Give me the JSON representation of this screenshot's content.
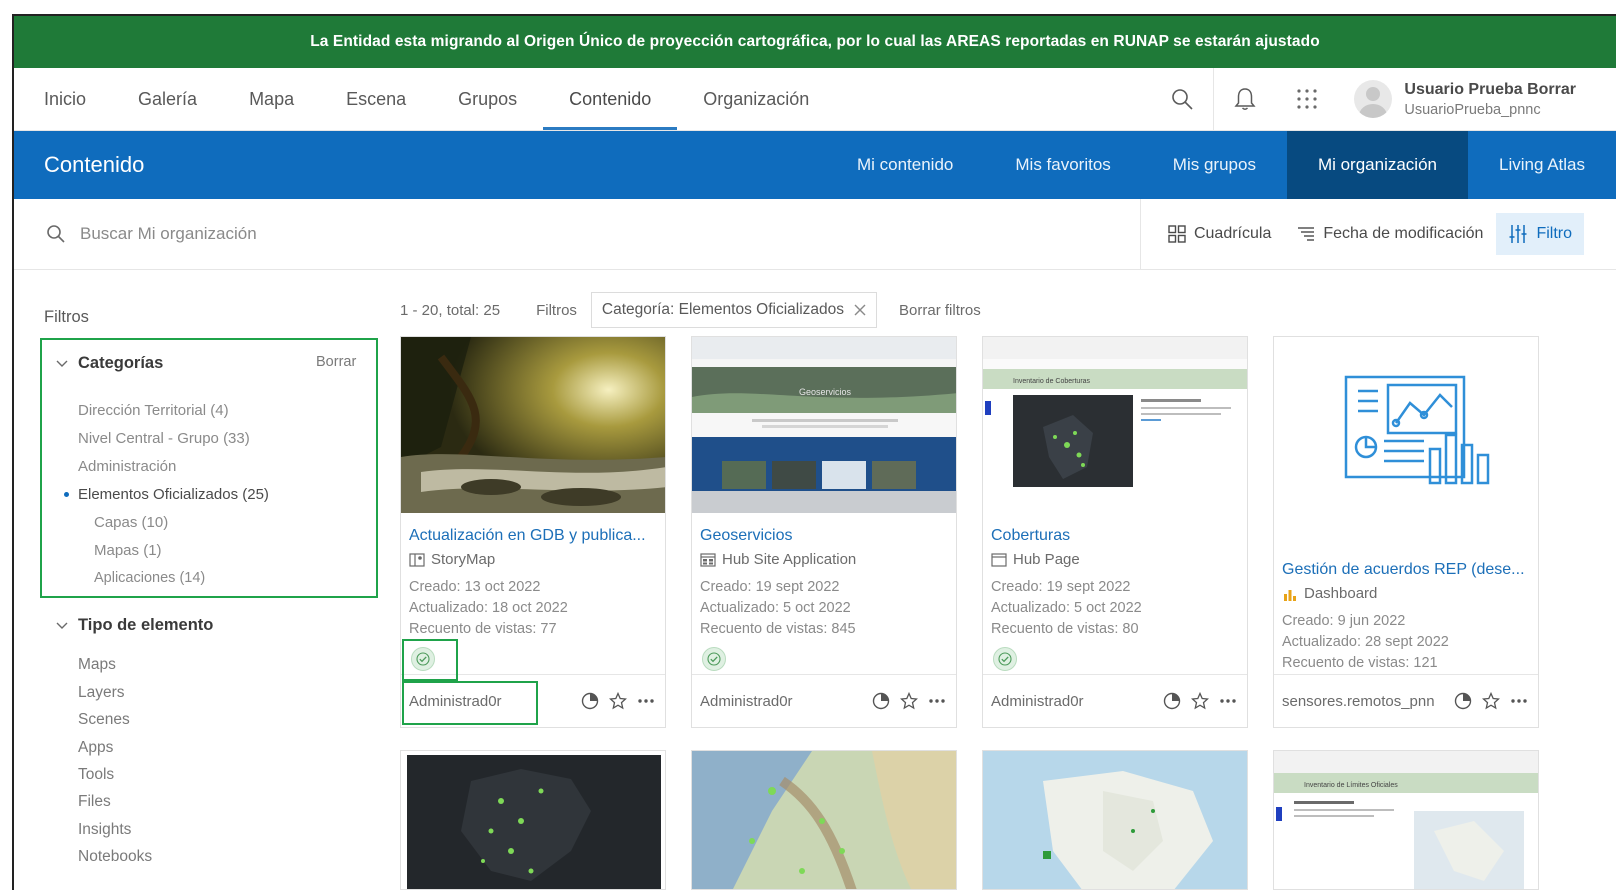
{
  "banner": {
    "text": "La Entidad esta migrando al Origen Único de proyección cartográfica, por lo cual las AREAS reportadas en RUNAP se estarán ajustado"
  },
  "topnav": {
    "items": [
      "Inicio",
      "Galería",
      "Mapa",
      "Escena",
      "Grupos",
      "Contenido",
      "Organización"
    ],
    "active": "Contenido"
  },
  "user": {
    "name": "Usuario Prueba Borrar",
    "handle": "UsuarioPrueba_pnnc"
  },
  "content_header": {
    "title": "Contenido",
    "tabs": [
      "Mi contenido",
      "Mis favoritos",
      "Mis grupos",
      "Mi organización",
      "Living Atlas"
    ],
    "active_tab": "Mi organización"
  },
  "search": {
    "placeholder": "Buscar Mi organización",
    "grid_label": "Cuadrícula",
    "sort_label": "Fecha de modificación",
    "filter_label": "Filtro"
  },
  "filters": {
    "title": "Filtros",
    "categories": {
      "heading": "Categorías",
      "clear": "Borrar",
      "items": [
        {
          "label": "Dirección Territorial",
          "count": "(4)"
        },
        {
          "label": "Nivel Central - Grupo",
          "count": "(33)"
        },
        {
          "label": "Administración",
          "count": ""
        },
        {
          "label": "Elementos Oficializados",
          "count": "(25)"
        },
        {
          "label": "Capas",
          "count": "(10)"
        },
        {
          "label": "Mapas",
          "count": "(1)"
        },
        {
          "label": "Aplicaciones",
          "count": "(14)"
        }
      ]
    },
    "item_type": {
      "heading": "Tipo de elemento",
      "items": [
        "Maps",
        "Layers",
        "Scenes",
        "Apps",
        "Tools",
        "Files",
        "Insights",
        "Notebooks"
      ]
    }
  },
  "results": {
    "summary": "1 - 20, total: 25",
    "filters_label": "Filtros",
    "active_filter": "Categoría: Elementos Oficializados",
    "clear_filters": "Borrar filtros"
  },
  "cards": [
    {
      "title": "Actualización en GDB y publica...",
      "type": "StoryMap",
      "created": "Creado: 13 oct 2022",
      "updated": "Actualizado: 18 oct 2022",
      "views": "Recuento de vistas: 77",
      "owner": "Administrad0r",
      "type_icon": "storymap-icon"
    },
    {
      "title": "Geoservicios",
      "type": "Hub Site Application",
      "created": "Creado: 19 sept 2022",
      "updated": "Actualizado: 5 oct 2022",
      "views": "Recuento de vistas: 845",
      "owner": "Administrad0r",
      "type_icon": "hub-site-icon",
      "thumb_text": "Geoservicios"
    },
    {
      "title": "Coberturas",
      "type": "Hub Page",
      "created": "Creado: 19 sept 2022",
      "updated": "Actualizado: 5 oct 2022",
      "views": "Recuento de vistas: 80",
      "owner": "Administrad0r",
      "type_icon": "hub-page-icon",
      "thumb_text": "Inventario de Coberturas"
    },
    {
      "title": "Gestión de acuerdos REP (dese...",
      "type": "Dashboard",
      "created": "Creado: 9 jun 2022",
      "updated": "Actualizado: 28 sept 2022",
      "views": "Recuento de vistas: 121",
      "owner": "sensores.remotos_pnn",
      "type_icon": "dashboard-icon"
    }
  ],
  "row2": {
    "card4_thumb_text": "Inventario de Límites Oficiales"
  },
  "colors": {
    "banner": "#1f7a38",
    "header": "#0f6cbd",
    "active_tab": "#074a80",
    "link": "#1c6fb8",
    "highlight": "#1fa34a"
  }
}
